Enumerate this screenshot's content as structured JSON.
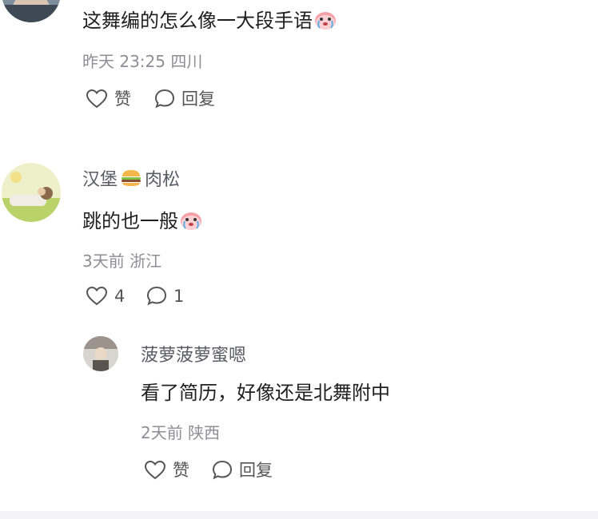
{
  "comments": [
    {
      "text": "这舞编的怎么像一大段手语",
      "emoji": "crying-face-icon",
      "time": "昨天 23:25",
      "location": "四川",
      "like_label": "赞",
      "reply_label": "回复"
    },
    {
      "username": "汉堡",
      "username_emoji": "hamburger-icon",
      "username_suffix": "肉松",
      "text": "跳的也一般",
      "emoji": "crying-face-icon",
      "time": "3天前",
      "location": "浙江",
      "like_count": "4",
      "reply_count": "1"
    },
    {
      "username": "菠萝菠萝蜜嗯",
      "text": "看了简历，好像还是北舞附中",
      "time": "2天前",
      "location": "陕西",
      "like_label": "赞",
      "reply_label": "回复"
    }
  ],
  "colors": {
    "username": "#5b5b66",
    "meta": "#8e8e96",
    "text": "#1f1f1f",
    "icon": "#555555"
  }
}
